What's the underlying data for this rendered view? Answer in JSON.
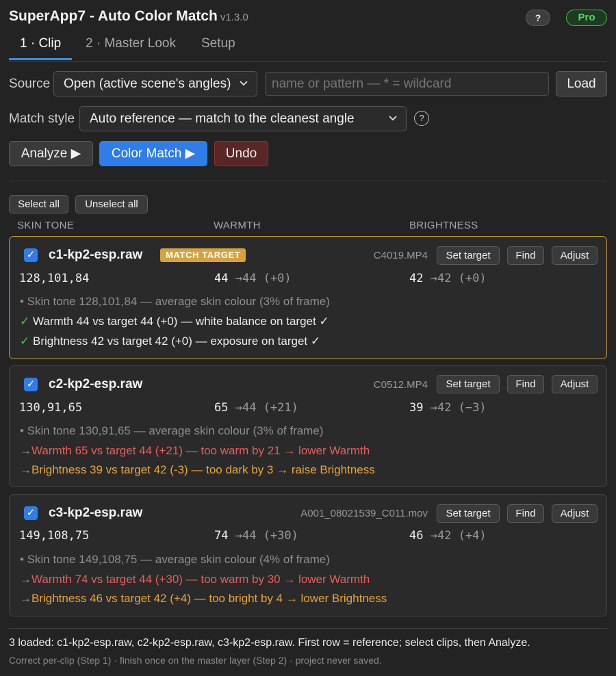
{
  "header": {
    "title": "SuperApp7 - Auto Color Match",
    "version": "v1.3.0",
    "help_label": "?",
    "pro_label": "Pro"
  },
  "tabs": [
    {
      "label": "1 · Clip",
      "active": true
    },
    {
      "label": "2 · Master Look",
      "active": false
    },
    {
      "label": "Setup",
      "active": false
    }
  ],
  "source": {
    "label": "Source",
    "selected": "Open (active scene's angles)",
    "placeholder": "name or pattern — * = wildcard",
    "load_label": "Load"
  },
  "match_style": {
    "label": "Match style",
    "selected": "Auto reference — match to the cleanest angle",
    "help_label": "?"
  },
  "actions": {
    "analyze": "Analyze ▶",
    "color_match": "Color Match ▶",
    "undo": "Undo"
  },
  "selection": {
    "select_all": "Select all",
    "unselect_all": "Unselect all"
  },
  "columns": {
    "skin_tone": "SKIN TONE",
    "warmth": "WARMTH",
    "brightness": "BRIGHTNESS"
  },
  "clips": [
    {
      "name": "c1-kp2-esp.raw",
      "checked": true,
      "badge": "MATCH TARGET",
      "file": "C4019.MP4",
      "skin": "128,101,84",
      "warmth_value": "44",
      "warmth_delta": "→44 (+0)",
      "brightness_value": "42",
      "brightness_delta": "→42 (+0)",
      "note_skin": "• Skin tone 128,101,84 — average skin colour (3% of frame)",
      "note_warmth_mark": "✓",
      "note_warmth": "Warmth 44 vs target 44 (+0) — white balance on target ✓",
      "note_brightness_mark": "✓",
      "note_brightness": "Brightness 42 vs target 42 (+0) — exposure on target ✓"
    },
    {
      "name": "c2-kp2-esp.raw",
      "checked": true,
      "file": "C0512.MP4",
      "skin": "130,91,65",
      "warmth_value": "65",
      "warmth_delta": "→44 (+21)",
      "brightness_value": "39",
      "brightness_delta": "→42 (−3)",
      "note_skin": "• Skin tone 130,91,65 — average skin colour (3% of frame)",
      "note_warmth_mark": "→",
      "note_warmth": "Warmth 65 vs target 44 (+21) — too warm by 21 → lower Warmth",
      "note_brightness_mark": "→",
      "note_brightness": "Brightness 39 vs target 42 (-3) — too dark by 3 → raise Brightness"
    },
    {
      "name": "c3-kp2-esp.raw",
      "checked": true,
      "file": "A001_08021539_C011.mov",
      "skin": "149,108,75",
      "warmth_value": "74",
      "warmth_delta": "→44 (+30)",
      "brightness_value": "46",
      "brightness_delta": "→42 (+4)",
      "note_skin": "• Skin tone 149,108,75 — average skin colour (4% of frame)",
      "note_warmth_mark": "→",
      "note_warmth": "Warmth 74 vs target 44 (+30) — too warm by 30 → lower Warmth",
      "note_brightness_mark": "→",
      "note_brightness": "Brightness 46 vs target 42 (+4) — too bright by 4 → lower Brightness"
    }
  ],
  "card_buttons": {
    "set_target": "Set target",
    "find": "Find",
    "adjust": "Adjust",
    "check_mark": "✓"
  },
  "footer": {
    "status": "3 loaded: c1-kp2-esp.raw, c2-kp2-esp.raw, c3-kp2-esp.raw. First row = reference; select clips, then Analyze.",
    "hint": "Correct per-clip (Step 1) · finish once on the master layer (Step 2) · project never saved."
  },
  "colors": {
    "accent": "#2f7de8",
    "badge": "#d5a33d",
    "ok": "#48c856",
    "warn_red": "#ec5c5c",
    "warn_amber": "#e9a43c",
    "pro": "#4fdc5e"
  }
}
